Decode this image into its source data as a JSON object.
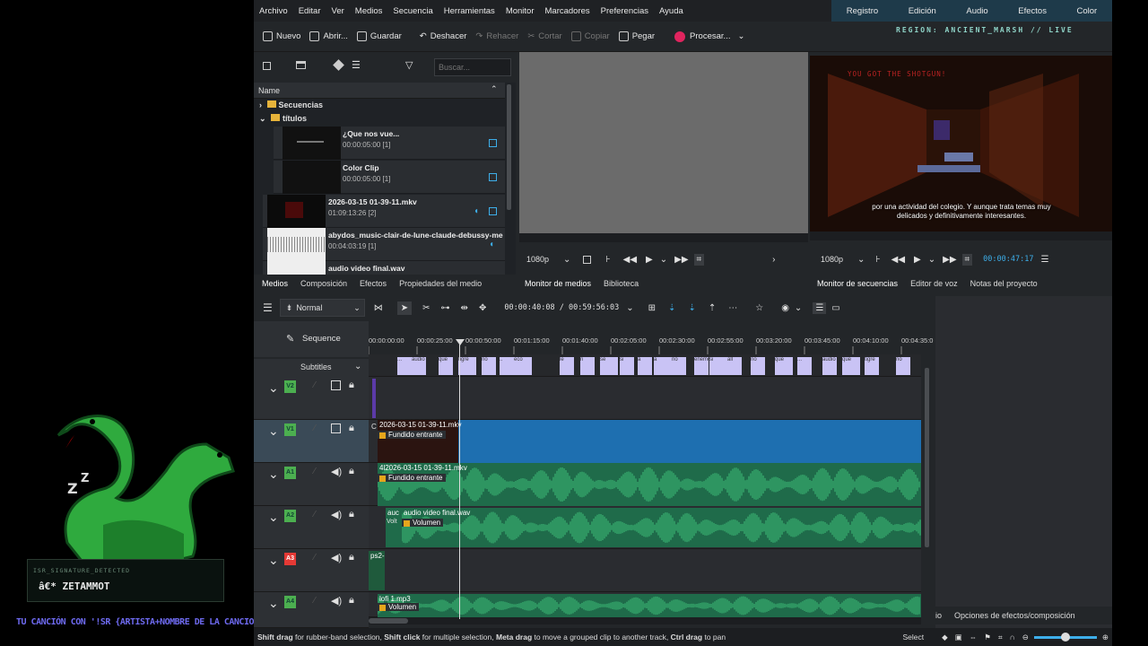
{
  "menu": [
    "Archivo",
    "Editar",
    "Ver",
    "Medios",
    "Secuencia",
    "Herramientas",
    "Monitor",
    "Marcadores",
    "Preferencias",
    "Ayuda"
  ],
  "workspaces": [
    "Registro",
    "Edición",
    "Audio",
    "Efectos",
    "Color"
  ],
  "toolbar": {
    "new": "Nuevo",
    "open": "Abrir...",
    "save": "Guardar",
    "undo": "Deshacer",
    "redo": "Rehacer",
    "cut": "Cortar",
    "copy": "Copiar",
    "paste": "Pegar",
    "render": "Procesar..."
  },
  "region": "REGION: ANCIENT_MARSH // LIVE",
  "bin": {
    "search_placeholder": "Buscar...",
    "col_name": "Name",
    "folders": [
      "Secuencias",
      "títulos"
    ],
    "clips": [
      {
        "name": "¿Que nos vue...",
        "dur": "00:00:05:00 [1]"
      },
      {
        "name": "Color Clip",
        "dur": "00:00:05:00 [1]"
      },
      {
        "name": "2026-03-15 01-39-11.mkv",
        "dur": "01:09:13:26 [2]"
      },
      {
        "name": "abydos_music-clair-de-lune-claude-debussy-me",
        "dur": "00:04:03:19 [1]"
      },
      {
        "name": "audio video final.wav",
        "dur": ""
      }
    ],
    "tabs": [
      "Medios",
      "Composición",
      "Efectos",
      "Propiedades del medio"
    ]
  },
  "clip_monitor": {
    "res": "1080p",
    "tabs": [
      "Monitor de medios",
      "Biblioteca"
    ]
  },
  "seq_monitor": {
    "res": "1080p",
    "timecode": "00:00:47:17",
    "tabs": [
      "Monitor de secuencias",
      "Editor de voz",
      "Notas del proyecto"
    ],
    "game_text": "YOU GOT THE SHOTGUN!",
    "subtitle": "por una actividad del colegio. Y aunque trata temas muy delicados y definitivamente interesantes."
  },
  "timeline": {
    "mode": "Normal",
    "timecode": "00:00:40:08 / 00:59:56:03",
    "sequence": "Sequence",
    "subtitles": "Subtitles",
    "ruler": [
      "00:00:00:00",
      "00:00:25:00",
      "00:00:50:00",
      "00:01:15:00",
      "00:01:40:00",
      "00:02:05:00",
      "00:02:30:00",
      "00:02:55:00",
      "00:03:20:00",
      "00:03:45:00",
      "00:04:10:00",
      "00:04:35:0"
    ],
    "subtitle_words": [
      "...",
      "audio",
      "que",
      "tigre",
      "no",
      "..",
      "eco",
      "le",
      "ri",
      "se",
      "si",
      "a",
      "a",
      "no",
      "enemo",
      "si",
      "all",
      "no",
      "que"
    ],
    "tracks": [
      {
        "tag": "V2",
        "color": "#4caf50"
      },
      {
        "tag": "V1",
        "color": "#4caf50"
      },
      {
        "tag": "A1",
        "color": "#4caf50"
      },
      {
        "tag": "A2",
        "color": "#4caf50"
      },
      {
        "tag": "A3",
        "color": "#e53935"
      },
      {
        "tag": "A4",
        "color": "#4caf50"
      }
    ],
    "v1": {
      "prefix": "C",
      "clip": "2026-03-15 01-39-11.mkv",
      "effect": "Fundido entrante"
    },
    "a1": {
      "clip": "4l2026-03-15 01-39-11.mkv",
      "effect": "Fundido entrante"
    },
    "a2": {
      "prefix": "auc",
      "clip": "audio video final.wav",
      "small": "Volt",
      "effect": "Volumen"
    },
    "a3": {
      "clip": "ps2-"
    },
    "a4": {
      "clip": "lofi 1.mp3",
      "effect": "Volumen"
    },
    "side_tabs": [
      "io",
      "Opciones de efectos/composición"
    ]
  },
  "status": {
    "hint_parts": [
      "Shift drag",
      " for rubber-band selection, ",
      "Shift click",
      " for multiple selection, ",
      "Meta drag",
      " to move a grouped clip to another track, ",
      "Ctrl drag",
      " to pan"
    ],
    "select": "Select"
  },
  "overlay": {
    "sig_label": "ISR_SIGNATURE_DETECTED",
    "sig_name": "â€* ZETAMMOT",
    "bottom": "TU CANCIÓN CON '!SR {ARTISTA+NOMBRE DE LA CANCION}'"
  },
  "colors": {
    "accent": "#3daee9",
    "clip_blue": "#1e6fb0",
    "audio_green": "#1f6b4a",
    "subtitle_lav": "#c9c3f5"
  }
}
